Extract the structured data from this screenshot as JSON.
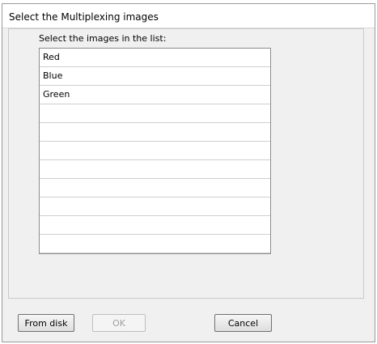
{
  "window": {
    "title": "Select the Multiplexing images"
  },
  "list": {
    "caption": "Select the images in the list:",
    "items": [
      "Red",
      "Blue",
      "Green",
      "",
      "",
      "",
      "",
      "",
      "",
      "",
      ""
    ]
  },
  "buttons": {
    "from_disk": "From disk",
    "ok": "OK",
    "cancel": "Cancel"
  },
  "state": {
    "ok_enabled": false
  }
}
